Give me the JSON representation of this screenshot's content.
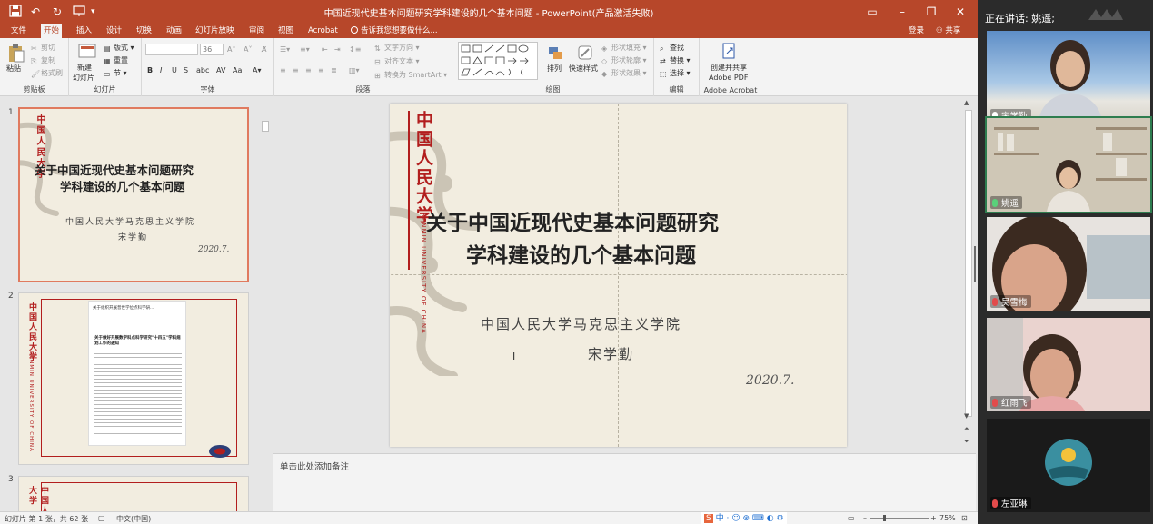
{
  "app": {
    "doc_title": "中国近现代史基本问题研究学科建设的几个基本问题 - PowerPoint(产品激活失败)",
    "login": "登录",
    "share": "共享"
  },
  "tabs": [
    "文件",
    "开始",
    "插入",
    "设计",
    "切换",
    "动画",
    "幻灯片放映",
    "审阅",
    "视图",
    "Acrobat"
  ],
  "tell_me": "告诉我您想要做什么...",
  "ribbon": {
    "clipboard": {
      "label": "剪贴板",
      "paste": "粘贴",
      "cut": "剪切",
      "copy": "复制",
      "format_painter": "格式刷"
    },
    "slides": {
      "label": "幻灯片",
      "new_slide_1": "新建",
      "new_slide_2": "幻灯片",
      "layout": "版式",
      "reset": "重置",
      "section": "节"
    },
    "font": {
      "label": "字体",
      "font_size": "36"
    },
    "paragraph": {
      "label": "段落",
      "text_direction": "文字方向",
      "align_text": "对齐文本",
      "smartart": "转换为 SmartArt"
    },
    "drawing": {
      "label": "绘图",
      "arrange": "排列",
      "quick_styles": "快速样式",
      "fill": "形状填充",
      "outline": "形状轮廓",
      "effects": "形状效果"
    },
    "editing": {
      "label": "编辑",
      "find": "查找",
      "replace": "替换",
      "select": "选择"
    },
    "acrobat": {
      "label": "Adobe Acrobat",
      "create_1": "创建并共享",
      "create_2": "Adobe PDF"
    }
  },
  "slide": {
    "vertical_school": "中国人民大学",
    "vertical_school_en": "RENMIN UNIVERSITY OF CHINA",
    "title_line1": "关于中国近现代史基本问题研究",
    "title_line2": "学科建设的几个基本问题",
    "institution": "中国人民大学马克思主义学院",
    "author": "宋学勤",
    "date": "2020.7."
  },
  "thumbnails": {
    "numbers": [
      "1",
      "2",
      "3"
    ],
    "doc_header": "关于组织开展普世学位点科学研...",
    "doc_heading": "关于做好开展数学科点科学研究\"十四五\"学科规划工作的通知"
  },
  "notes_placeholder": "单击此处添加备注",
  "status": {
    "slide_counter": "幻灯片 第 1 张，共 62 张",
    "language": "中文(中国)",
    "zoom": "75%"
  },
  "meeting": {
    "now_speaking": "正在讲话: 姚遥;",
    "participants": [
      {
        "name": "宋学勤",
        "mic": "on"
      },
      {
        "name": "姚遥",
        "mic": "on"
      },
      {
        "name": "吴雪梅",
        "mic": "off"
      },
      {
        "name": "红雨飞",
        "mic": "off"
      },
      {
        "name": "左亚琳",
        "mic": "off"
      }
    ]
  },
  "colors": {
    "ppt_brand": "#b7472a",
    "slide_red": "#b21e1e",
    "slide_bg": "#f2ede0",
    "active_speaker": "#2e7d4f"
  }
}
